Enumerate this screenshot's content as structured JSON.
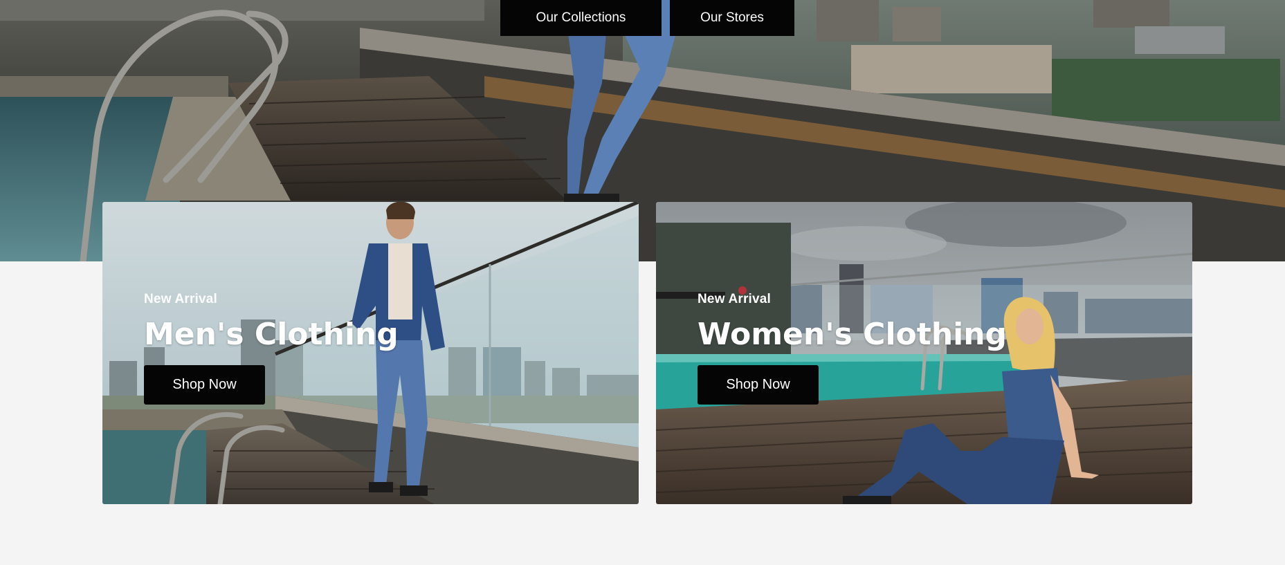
{
  "nav": {
    "collections_label": "Our Collections",
    "stores_label": "Our Stores"
  },
  "cards": [
    {
      "eyebrow": "New Arrival",
      "title": "Men's Clothing",
      "button_label": "Shop Now"
    },
    {
      "eyebrow": "New Arrival",
      "title": "Women's Clothing",
      "button_label": "Shop Now"
    }
  ],
  "colors": {
    "page_background": "#f4f4f4",
    "button_background": "#050505",
    "button_text": "#ffffff",
    "overlay_text": "#ffffff"
  }
}
